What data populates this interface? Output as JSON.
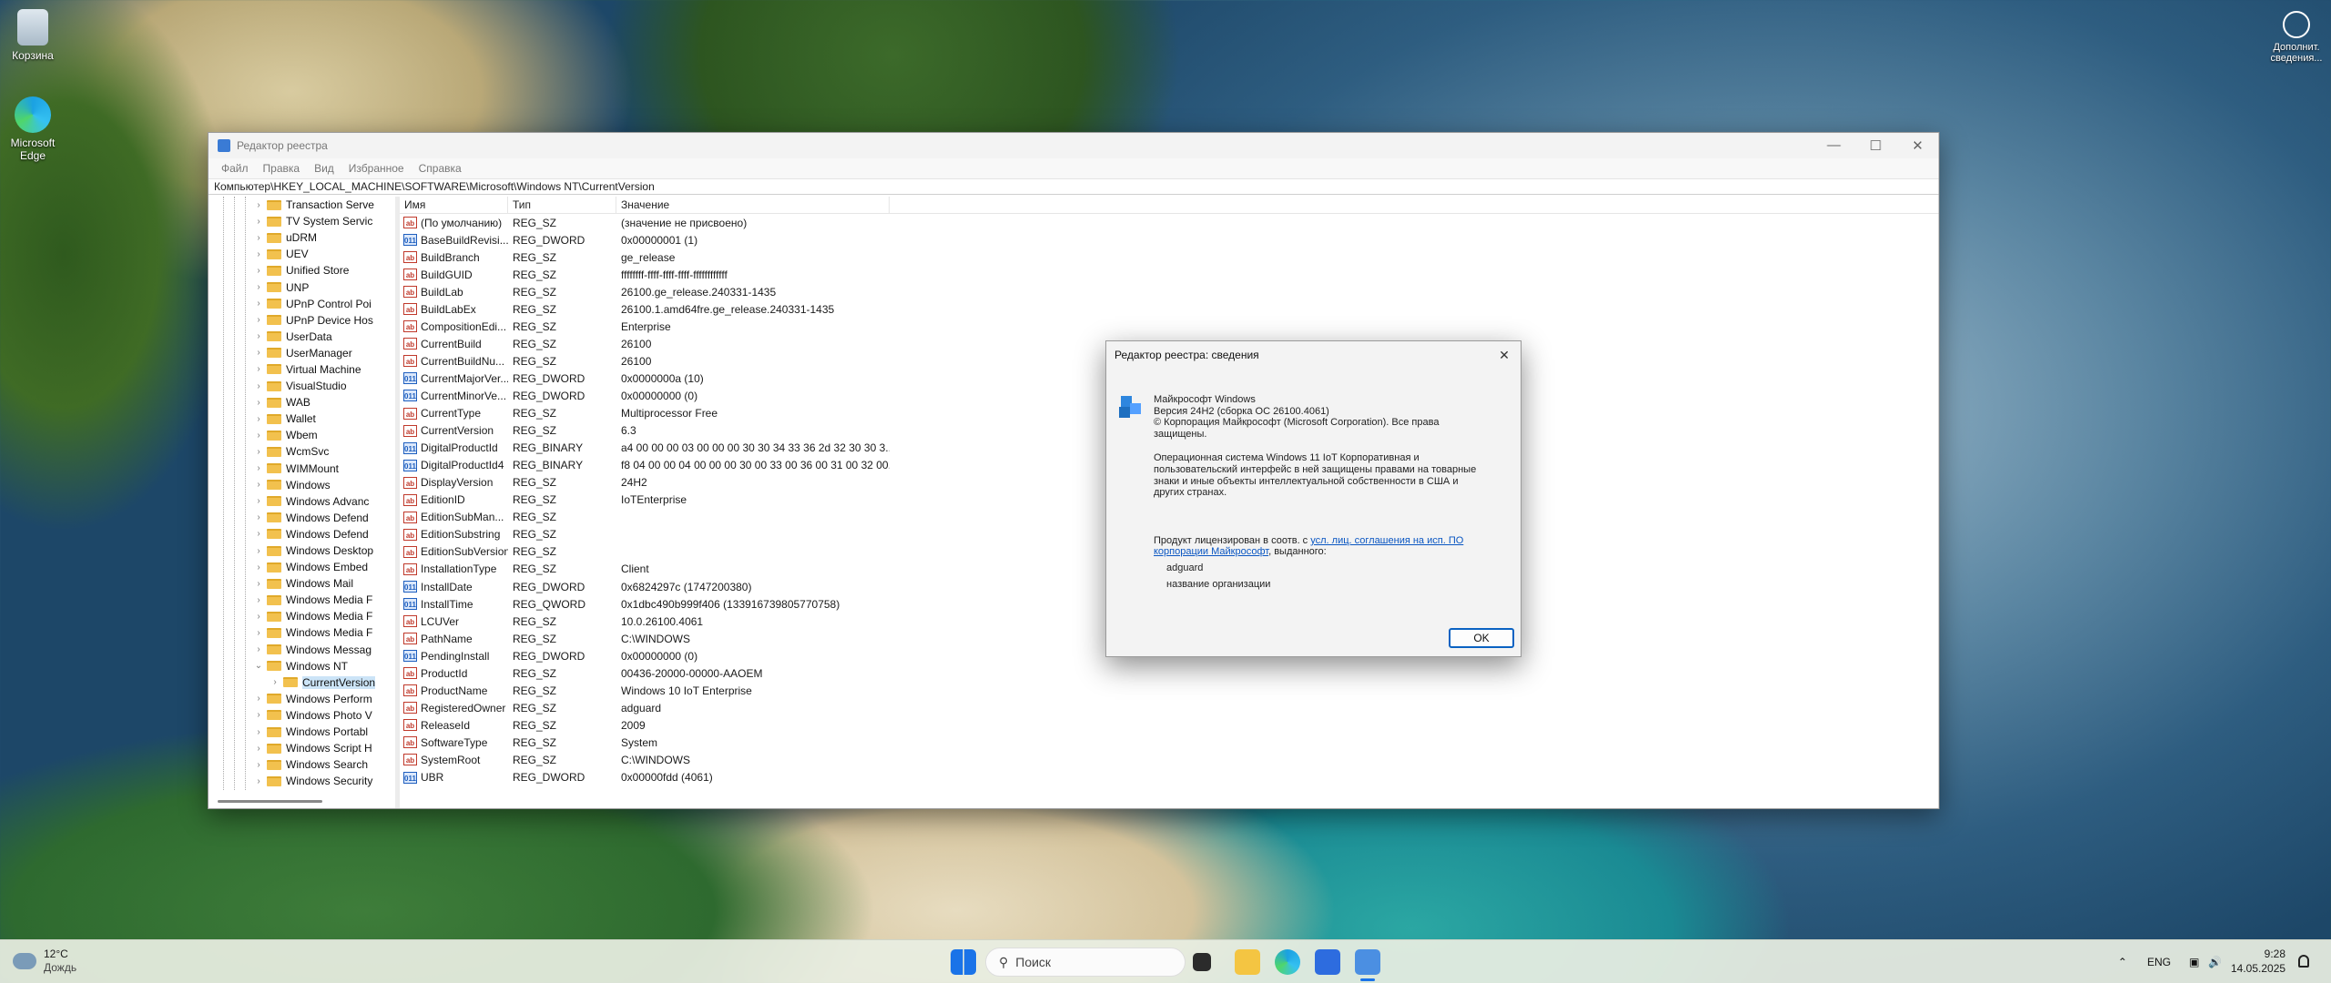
{
  "desktop": {
    "icons": [
      {
        "label": "Корзина"
      },
      {
        "label": "Microsoft Edge"
      }
    ],
    "notification_label": "Дополнит. сведения..."
  },
  "window": {
    "title": "Редактор реестра",
    "menu": [
      "Файл",
      "Правка",
      "Вид",
      "Избранное",
      "Справка"
    ],
    "address": "Компьютер\\HKEY_LOCAL_MACHINE\\SOFTWARE\\Microsoft\\Windows NT\\CurrentVersion",
    "tree": [
      {
        "label": "Transaction Serve"
      },
      {
        "label": "TV System Servic"
      },
      {
        "label": "uDRM"
      },
      {
        "label": "UEV"
      },
      {
        "label": "Unified Store"
      },
      {
        "label": "UNP"
      },
      {
        "label": "UPnP Control Poi"
      },
      {
        "label": "UPnP Device Hos"
      },
      {
        "label": "UserData"
      },
      {
        "label": "UserManager"
      },
      {
        "label": "Virtual Machine"
      },
      {
        "label": "VisualStudio"
      },
      {
        "label": "WAB"
      },
      {
        "label": "Wallet"
      },
      {
        "label": "Wbem"
      },
      {
        "label": "WcmSvc"
      },
      {
        "label": "WIMMount"
      },
      {
        "label": "Windows"
      },
      {
        "label": "Windows Advanc"
      },
      {
        "label": "Windows Defend"
      },
      {
        "label": "Windows Defend"
      },
      {
        "label": "Windows Desktop"
      },
      {
        "label": "Windows Embed"
      },
      {
        "label": "Windows Mail"
      },
      {
        "label": "Windows Media F"
      },
      {
        "label": "Windows Media F"
      },
      {
        "label": "Windows Media F"
      },
      {
        "label": "Windows Messag"
      },
      {
        "label": "Windows NT"
      },
      {
        "label": "CurrentVersion"
      },
      {
        "label": "Windows Perform"
      },
      {
        "label": "Windows Photo V"
      },
      {
        "label": "Windows Portabl"
      },
      {
        "label": "Windows Script H"
      },
      {
        "label": "Windows Search"
      },
      {
        "label": "Windows Security"
      }
    ],
    "columns": [
      "Имя",
      "Тип",
      "Значение"
    ],
    "values": [
      {
        "icon": "ab",
        "name": "(По умолчанию)",
        "type": "REG_SZ",
        "data": "(значение не присвоено)"
      },
      {
        "icon": "bin",
        "name": "BaseBuildRevisi...",
        "type": "REG_DWORD",
        "data": "0x00000001 (1)"
      },
      {
        "icon": "ab",
        "name": "BuildBranch",
        "type": "REG_SZ",
        "data": "ge_release"
      },
      {
        "icon": "ab",
        "name": "BuildGUID",
        "type": "REG_SZ",
        "data": "ffffffff-ffff-ffff-ffff-ffffffffffff"
      },
      {
        "icon": "ab",
        "name": "BuildLab",
        "type": "REG_SZ",
        "data": "26100.ge_release.240331-1435"
      },
      {
        "icon": "ab",
        "name": "BuildLabEx",
        "type": "REG_SZ",
        "data": "26100.1.amd64fre.ge_release.240331-1435"
      },
      {
        "icon": "ab",
        "name": "CompositionEdi...",
        "type": "REG_SZ",
        "data": "Enterprise"
      },
      {
        "icon": "ab",
        "name": "CurrentBuild",
        "type": "REG_SZ",
        "data": "26100"
      },
      {
        "icon": "ab",
        "name": "CurrentBuildNu...",
        "type": "REG_SZ",
        "data": "26100"
      },
      {
        "icon": "bin",
        "name": "CurrentMajorVer...",
        "type": "REG_DWORD",
        "data": "0x0000000a (10)"
      },
      {
        "icon": "bin",
        "name": "CurrentMinorVe...",
        "type": "REG_DWORD",
        "data": "0x00000000 (0)"
      },
      {
        "icon": "ab",
        "name": "CurrentType",
        "type": "REG_SZ",
        "data": "Multiprocessor Free"
      },
      {
        "icon": "ab",
        "name": "CurrentVersion",
        "type": "REG_SZ",
        "data": "6.3"
      },
      {
        "icon": "bin",
        "name": "DigitalProductId",
        "type": "REG_BINARY",
        "data": "a4 00 00 00 03 00 00 00 30 30 34 33 36 2d 32 30 30 3..."
      },
      {
        "icon": "bin",
        "name": "DigitalProductId4",
        "type": "REG_BINARY",
        "data": "f8 04 00 00 04 00 00 00 30 00 33 00 36 00 31 00 32 00..."
      },
      {
        "icon": "ab",
        "name": "DisplayVersion",
        "type": "REG_SZ",
        "data": "24H2"
      },
      {
        "icon": "ab",
        "name": "EditionID",
        "type": "REG_SZ",
        "data": "IoTEnterprise"
      },
      {
        "icon": "ab",
        "name": "EditionSubMan...",
        "type": "REG_SZ",
        "data": ""
      },
      {
        "icon": "ab",
        "name": "EditionSubstring",
        "type": "REG_SZ",
        "data": ""
      },
      {
        "icon": "ab",
        "name": "EditionSubVersion",
        "type": "REG_SZ",
        "data": ""
      },
      {
        "icon": "ab",
        "name": "InstallationType",
        "type": "REG_SZ",
        "data": "Client"
      },
      {
        "icon": "bin",
        "name": "InstallDate",
        "type": "REG_DWORD",
        "data": "0x6824297c (1747200380)"
      },
      {
        "icon": "bin",
        "name": "InstallTime",
        "type": "REG_QWORD",
        "data": "0x1dbc490b999f406 (133916739805770758)"
      },
      {
        "icon": "ab",
        "name": "LCUVer",
        "type": "REG_SZ",
        "data": "10.0.26100.4061"
      },
      {
        "icon": "ab",
        "name": "PathName",
        "type": "REG_SZ",
        "data": "C:\\WINDOWS"
      },
      {
        "icon": "bin",
        "name": "PendingInstall",
        "type": "REG_DWORD",
        "data": "0x00000000 (0)"
      },
      {
        "icon": "ab",
        "name": "ProductId",
        "type": "REG_SZ",
        "data": "00436-20000-00000-AAOEM"
      },
      {
        "icon": "ab",
        "name": "ProductName",
        "type": "REG_SZ",
        "data": "Windows 10 IoT Enterprise"
      },
      {
        "icon": "ab",
        "name": "RegisteredOwner",
        "type": "REG_SZ",
        "data": "adguard"
      },
      {
        "icon": "ab",
        "name": "ReleaseId",
        "type": "REG_SZ",
        "data": "2009"
      },
      {
        "icon": "ab",
        "name": "SoftwareType",
        "type": "REG_SZ",
        "data": "System"
      },
      {
        "icon": "ab",
        "name": "SystemRoot",
        "type": "REG_SZ",
        "data": "C:\\WINDOWS"
      },
      {
        "icon": "bin",
        "name": "UBR",
        "type": "REG_DWORD",
        "data": "0x00000fdd (4061)"
      }
    ]
  },
  "dialog": {
    "title": "Редактор реестра: сведения",
    "line1": "Майкрософт Windows",
    "line2": "Версия 24H2 (сборка ОС 26100.4061)",
    "line3": "© Корпорация Майкрософт (Microsoft Corporation). Все права защищены.",
    "para": "Операционная система Windows 11 IoT Корпоративная и пользовательский интерфейс в ней защищены правами на товарные знаки и иные объекты интеллектуальной собственности в США и других странах.",
    "license_prefix": "Продукт лицензирован в соотв. с ",
    "license_link": "усл. лиц. соглашения на исп. ПО корпорации Майкрософт",
    "license_suffix": ", выданного:",
    "owner": "adguard",
    "org": "название организации",
    "ok": "OK"
  },
  "taskbar": {
    "weather_temp": "12°C",
    "weather_desc": "Дождь",
    "search_placeholder": "Поиск",
    "lang": "ENG",
    "time": "9:28",
    "date": "14.05.2025"
  }
}
